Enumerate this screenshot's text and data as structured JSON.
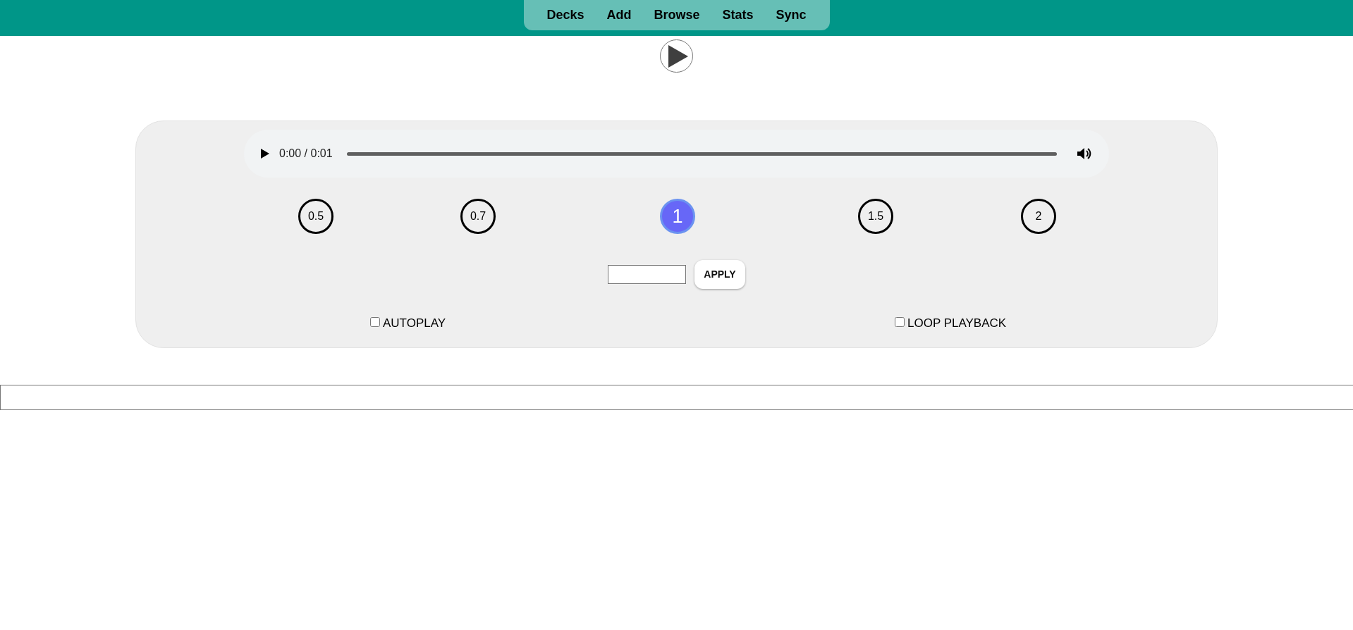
{
  "nav": [
    {
      "label": "Decks"
    },
    {
      "label": "Add"
    },
    {
      "label": "Browse"
    },
    {
      "label": "Stats"
    },
    {
      "label": "Sync"
    }
  ],
  "audio": {
    "time": "0:00 / 0:01"
  },
  "speeds": [
    {
      "label": "0.5",
      "selected": false
    },
    {
      "label": "0.7",
      "selected": false
    },
    {
      "label": "1",
      "selected": true
    },
    {
      "label": "1.5",
      "selected": false
    },
    {
      "label": "2",
      "selected": false
    }
  ],
  "apply": {
    "label": "APPLY"
  },
  "options": [
    {
      "label": "AUTOPLAY",
      "checked": false
    },
    {
      "label": "LOOP PLAYBACK",
      "checked": false
    }
  ]
}
